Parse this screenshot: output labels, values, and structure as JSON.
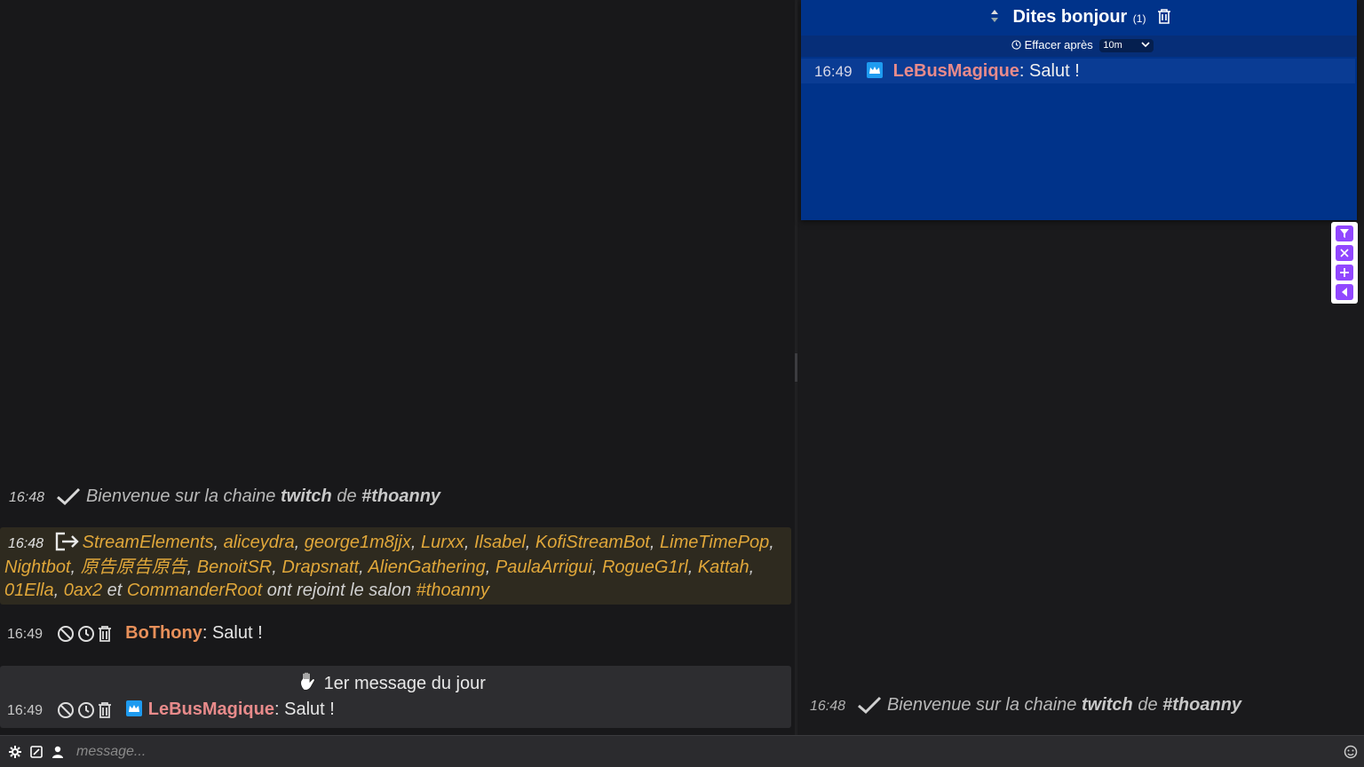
{
  "left_chat": {
    "welcome": {
      "time": "16:48",
      "prefix": "Bienvenue sur la chaine ",
      "platform": "twitch",
      "mid": " de ",
      "channel": "#thoanny"
    },
    "joins": {
      "time": "16:48",
      "users": [
        "StreamElements",
        "aliceydra",
        "george1m8jjx",
        "Lurxx",
        "Ilsabel",
        "KofiStreamBot",
        "LimeTimePop",
        "Nightbot",
        "原告原告原告",
        "BenoitSR",
        "Drapsnatt",
        "AlienGathering",
        "PaulaArrigui",
        "RogueG1rl",
        "Kattah",
        "01Ella",
        "0ax2"
      ],
      "and_word": "et",
      "last_user": "CommanderRoot",
      "suffix": "ont rejoint le salon",
      "channel": "#thoanny"
    },
    "messages": [
      {
        "time": "16:49",
        "user": "BoThony",
        "text": "Salut !",
        "user_color": "#e8905a"
      },
      {
        "time": "16:49",
        "user": "LeBusMagique",
        "text": "Salut !",
        "user_color": "#e88b8b"
      }
    ],
    "first_message_label": "1er message du jour"
  },
  "filter_panel": {
    "title": "Dites bonjour",
    "count": "(1)",
    "clear_label": "Effacer après",
    "clear_value": "10m",
    "message": {
      "time": "16:49",
      "user": "LeBusMagique",
      "text": "Salut !"
    }
  },
  "right_chat": {
    "welcome": {
      "time": "16:48",
      "prefix": "Bienvenue sur la chaine ",
      "platform": "twitch",
      "mid": " de ",
      "channel": "#thoanny"
    }
  },
  "input": {
    "placeholder": "message..."
  },
  "colors": {
    "accent": "#9147ff",
    "panel": "#00338a",
    "join_user": "#e0a73a"
  }
}
